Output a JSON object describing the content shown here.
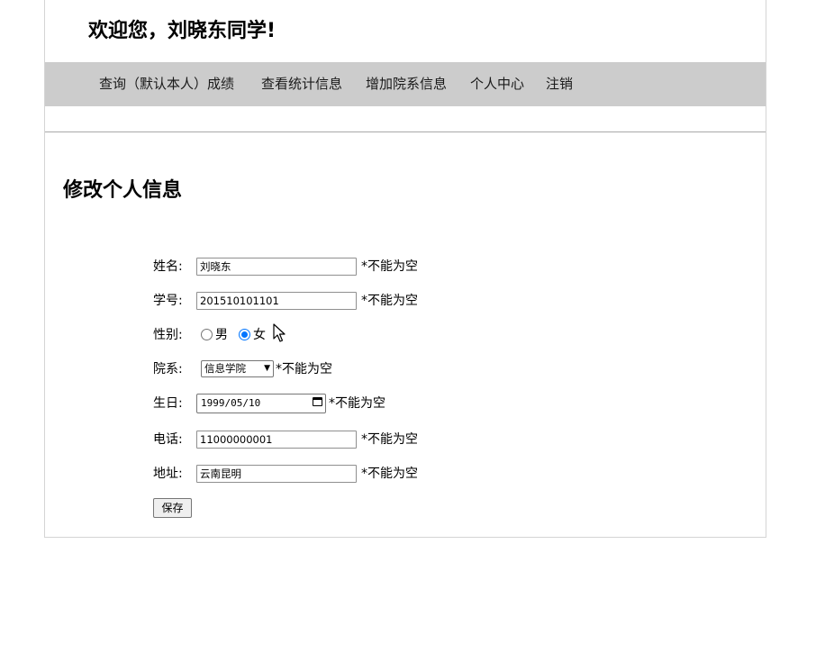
{
  "header": {
    "welcome": "欢迎您，刘晓东同学!"
  },
  "nav": {
    "items": [
      {
        "label": "查询（默认本人）成绩"
      },
      {
        "label": "查看统计信息"
      },
      {
        "label": "增加院系信息"
      },
      {
        "label": "个人中心"
      },
      {
        "label": "注销"
      }
    ]
  },
  "main": {
    "title": "修改个人信息"
  },
  "form": {
    "name_label": "姓名:",
    "name_value": "刘晓东",
    "name_hint": "*不能为空",
    "id_label": "学号:",
    "id_value": "201510101101",
    "id_hint": "*不能为空",
    "gender_label": "性别:",
    "gender_male": "男",
    "gender_female": "女",
    "gender_selected": "女",
    "dept_label": "院系:",
    "dept_value": "信息学院",
    "dept_hint": "*不能为空",
    "birth_label": "生日:",
    "birth_value": "1999/05/10",
    "birth_hint": "*不能为空",
    "phone_label": "电话:",
    "phone_value": "11000000001",
    "phone_hint": "*不能为空",
    "address_label": "地址:",
    "address_value": "云南昆明",
    "address_hint": "*不能为空",
    "save_label": "保存"
  },
  "colors": {
    "nav_bg": "#cccccc",
    "radio_accent": "#0075ff"
  }
}
